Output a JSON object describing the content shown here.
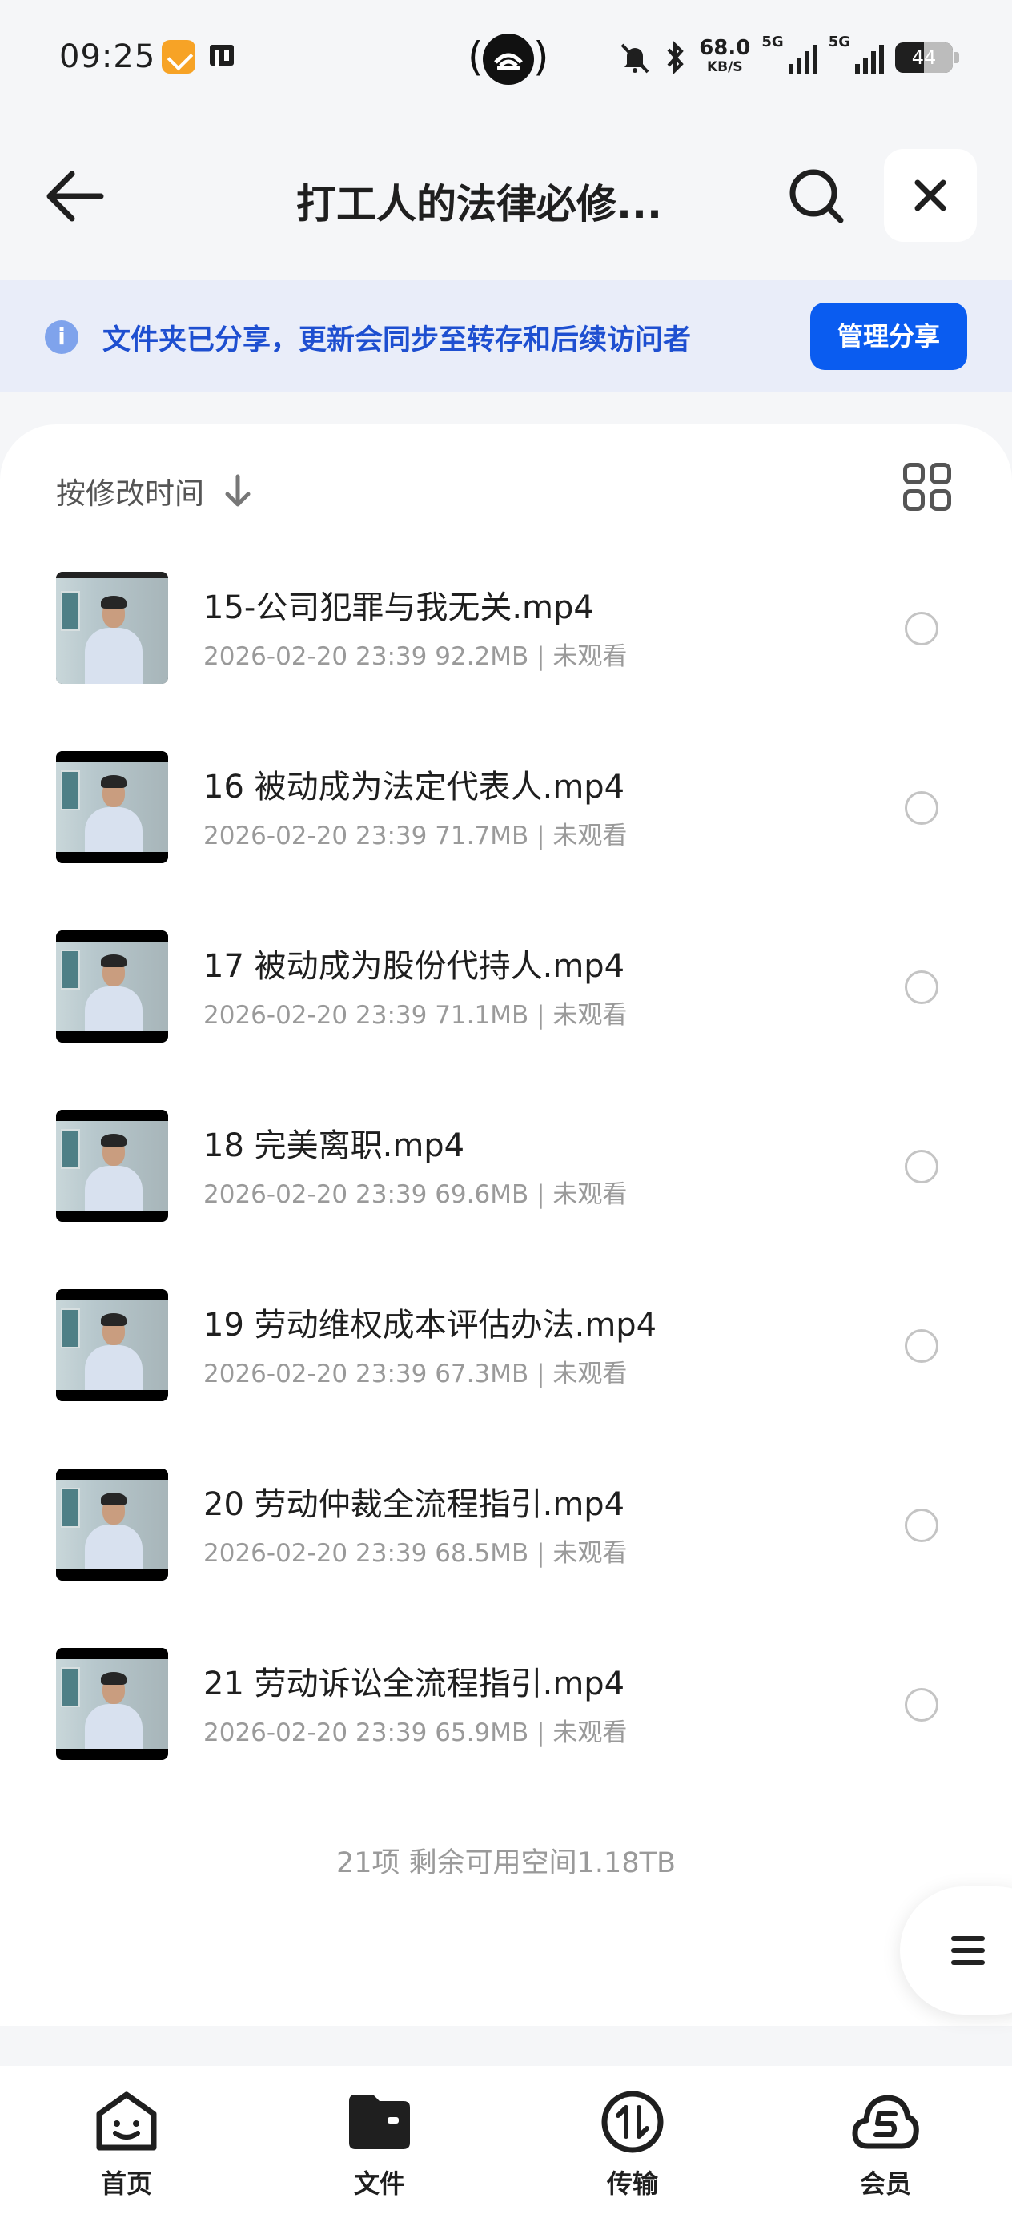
{
  "status_bar": {
    "time": "09:25",
    "speed_value": "68.0",
    "speed_unit": "KB/S",
    "net1": "5G",
    "net2": "5G",
    "battery": "44"
  },
  "header": {
    "title": "打工人的法律必修..."
  },
  "share_banner": {
    "message": "文件夹已分享，更新会同步至转存和后续访问者",
    "manage_label": "管理分享"
  },
  "sort": {
    "label": "按修改时间"
  },
  "files": [
    {
      "name": "15-公司犯罪与我无关.mp4",
      "meta": "2026-02-20 23:39  92.2MB | 未观看"
    },
    {
      "name": "16 被动成为法定代表人.mp4",
      "meta": "2026-02-20 23:39  71.7MB | 未观看"
    },
    {
      "name": "17 被动成为股份代持人.mp4",
      "meta": "2026-02-20 23:39  71.1MB | 未观看"
    },
    {
      "name": "18 完美离职.mp4",
      "meta": "2026-02-20 23:39  69.6MB | 未观看"
    },
    {
      "name": "19 劳动维权成本评估办法.mp4",
      "meta": "2026-02-20 23:39  67.3MB | 未观看"
    },
    {
      "name": "20 劳动仲裁全流程指引.mp4",
      "meta": "2026-02-20 23:39  68.5MB | 未观看"
    },
    {
      "name": "21 劳动诉讼全流程指引.mp4",
      "meta": "2026-02-20 23:39  65.9MB | 未观看"
    }
  ],
  "summary": "21项 剩余可用空间1.18TB",
  "nav": [
    {
      "label": "首页",
      "icon": "home-face-icon"
    },
    {
      "label": "文件",
      "icon": "folder-icon"
    },
    {
      "label": "传输",
      "icon": "transfer-icon"
    },
    {
      "label": "会员",
      "icon": "vip-cloud-icon"
    }
  ],
  "colors": {
    "accent": "#0a5cf0",
    "banner_bg": "#e9edf9",
    "banner_text": "#1e4fd0"
  }
}
